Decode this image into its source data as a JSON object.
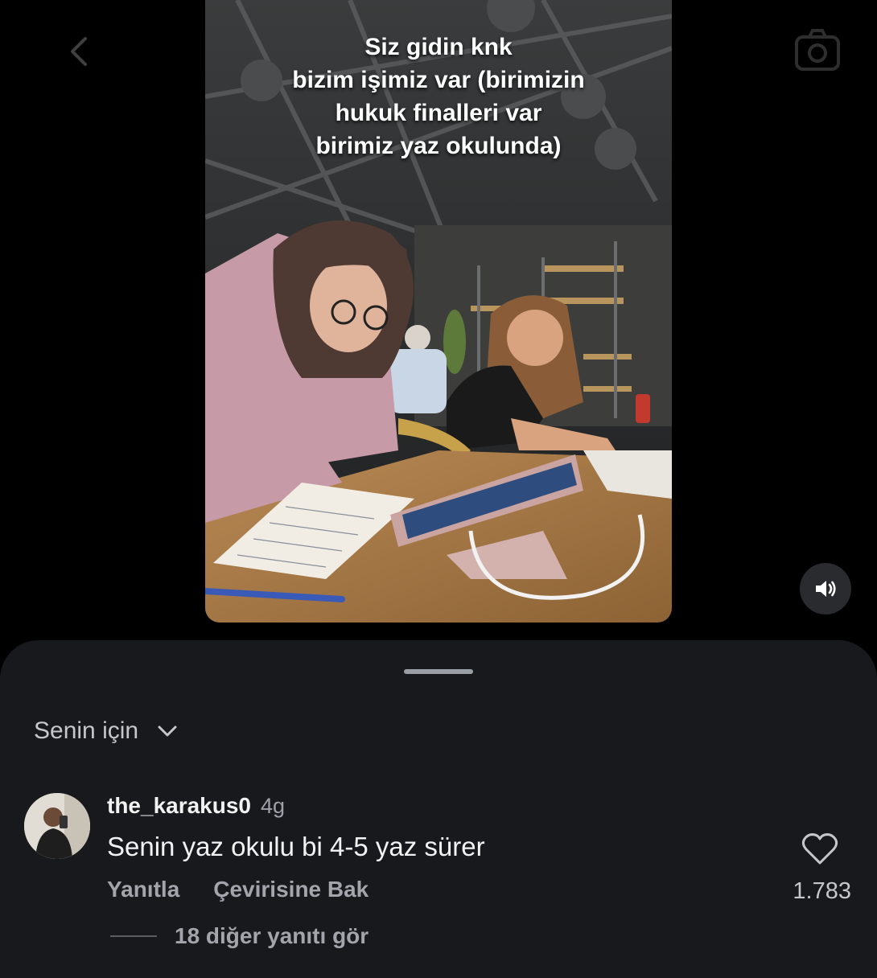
{
  "video": {
    "caption_lines": [
      "Siz gidin knk",
      "bizim işimiz var (birimizin",
      "hukuk finalleri var",
      "birimiz yaz okulunda)"
    ]
  },
  "comments_sheet": {
    "sort_label": "Senin için",
    "comment": {
      "username": "the_karakus0",
      "time": "4g",
      "text": "Senin yaz okulu bi 4-5 yaz sürer",
      "reply_label": "Yanıtla",
      "translate_label": "Çevirisine Bak",
      "like_count": "1.783",
      "view_replies_label": "18 diğer yanıtı gör"
    }
  },
  "icons": [
    "back-icon",
    "camera-icon",
    "volume-icon",
    "chevron-down-icon",
    "heart-icon"
  ],
  "colors": {
    "background": "#000000",
    "sheet": "#17191c",
    "primary_text": "#f2f2f2",
    "secondary_text": "#a2a6ac"
  }
}
